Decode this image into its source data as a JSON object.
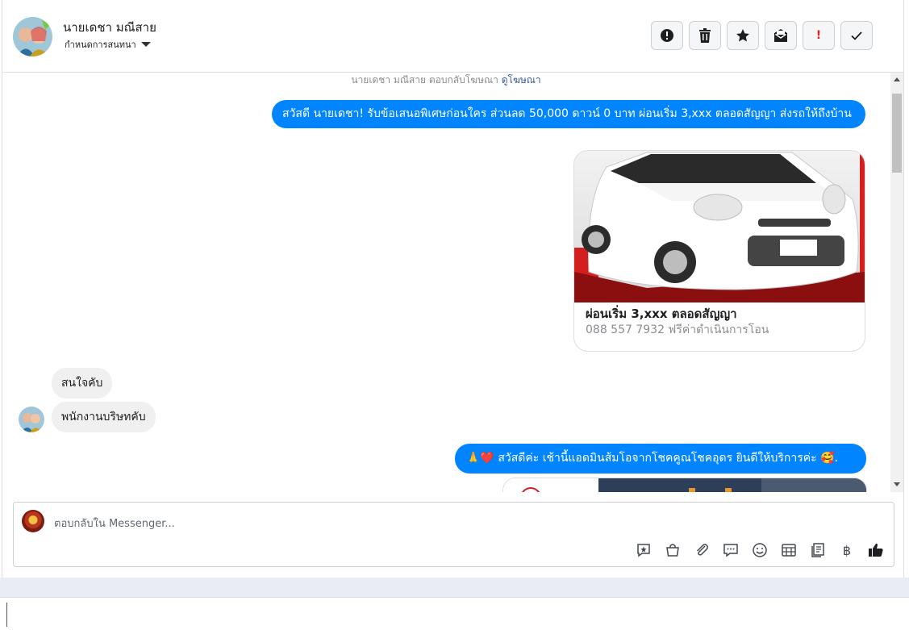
{
  "header": {
    "contact_name": "นายเดชา มณีสาย",
    "assign_label": "กำหนดการสนทนา",
    "actions": [
      {
        "name": "spam-button",
        "icon": "alert-circle-icon",
        "glyph": "❗"
      },
      {
        "name": "delete-button",
        "icon": "trash-icon",
        "glyph": "🗑"
      },
      {
        "name": "star-button",
        "icon": "star-icon",
        "glyph": "★"
      },
      {
        "name": "mark-unread-button",
        "icon": "envelope-icon",
        "glyph": "✉"
      },
      {
        "name": "follow-up-button",
        "icon": "exclamation-icon",
        "glyph": "!"
      },
      {
        "name": "done-button",
        "icon": "check-icon",
        "glyph": "✓"
      }
    ]
  },
  "chat": {
    "system_note": "นายเดชา มณีสาย ตอบกลับโฆษณา",
    "system_link": "ดูโฆษณา",
    "messages": [
      {
        "id": "m1",
        "text": "สวัสดี นายเดชา! รับข้อเสนอพิเศษก่อนใคร ส่วนลด 50,000 ดาวน์ 0 บาท ผ่อนเริ่ม 3,xxx ตลอดสัญญา ส่งรถให้ถึงบ้าน"
      },
      {
        "id": "m2",
        "text": "สนใจคับ"
      },
      {
        "id": "m3",
        "text": "พนักงานบริษทคับ"
      },
      {
        "id": "m4",
        "text": "🙏❤️ สวัสดีค่ะ เช้านี้แอดมินส้มโอจากโชคคูณโชคอุดร ยินดีให้บริการค่ะ 🥰."
      }
    ],
    "ad_card": {
      "title": "ผ่อนเริ่ม 3,xxx ตลอดสัญญา",
      "subtitle": "088 557 7932 ฟรีค่าดำเนินการโอน"
    }
  },
  "composer": {
    "placeholder": "ตอบกลับใน Messenger...",
    "tools": [
      "saved-reply-icon",
      "shopping-bag-icon",
      "attachment-icon",
      "chat-bubbles-icon",
      "emoji-icon",
      "table-icon",
      "notes-icon",
      "baht-icon",
      "like-icon"
    ]
  },
  "colors": {
    "accent": "#0084ff",
    "incoming_bubble": "#f0f0f0"
  }
}
